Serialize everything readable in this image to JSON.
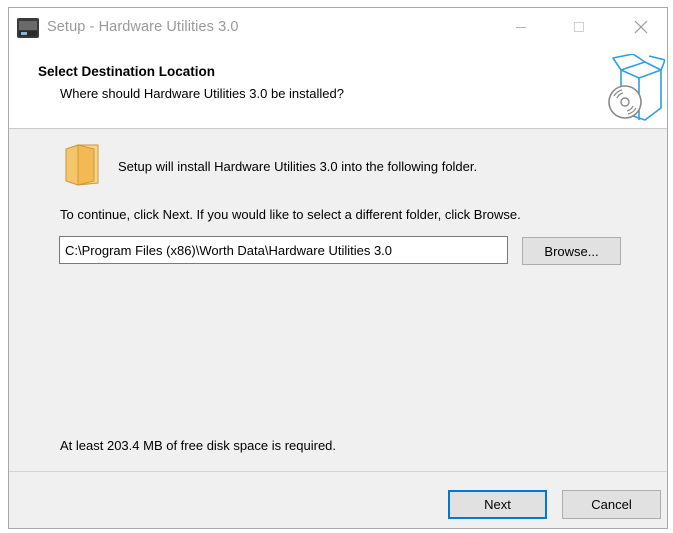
{
  "window": {
    "title": "Setup - Hardware Utilities 3.0",
    "controls": [
      "minimize-icon",
      "maximize-icon",
      "close-icon"
    ]
  },
  "header": {
    "title": "Select Destination Location",
    "subtitle": "Where should Hardware Utilities 3.0 be installed?",
    "icon": "install-box-cd-icon"
  },
  "body": {
    "intro": "Setup will install Hardware Utilities 3.0 into the following folder.",
    "instruction": "To continue, click Next. If you would like to select a different folder, click Browse.",
    "folder_icon": "folder-icon",
    "path_value": "C:\\Program Files (x86)\\Worth Data\\Hardware Utilities 3.0",
    "browse_label": "Browse...",
    "disk_space": "At least 203.4 MB of free disk space is required."
  },
  "footer": {
    "next_label": "Next",
    "cancel_label": "Cancel"
  },
  "colors": {
    "accent": "#0078d7",
    "folder": "#f5c46b",
    "header_icon": "#2f9ee0"
  }
}
